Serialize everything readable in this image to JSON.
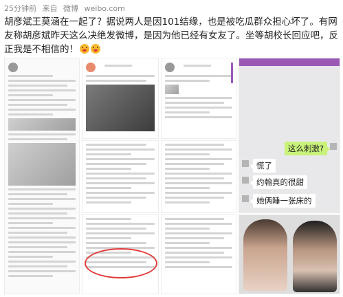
{
  "meta": {
    "time": "25分钟前",
    "from": "来自",
    "source": "微博",
    "site": "weibo.com"
  },
  "post": {
    "text": "胡彦斌王莫涵在一起了？据说两人是因101结缘，也是被吃瓜群众担心坏了。有网友称胡彦斌昨天这么决绝发微博，是因为他已经有女友了。坐等胡校长回应吧，反正我是不相信的！",
    "emojis": [
      "laugh-emoji",
      "laugh-emoji"
    ]
  },
  "images": {
    "count": 9,
    "chat": {
      "messages": [
        {
          "side": "right",
          "text": "这么刺激?"
        },
        {
          "side": "left",
          "text": "慌了"
        },
        {
          "side": "left",
          "text": "约翰真的很甜"
        },
        {
          "side": "left",
          "text": "她俩睡一张床的"
        }
      ]
    },
    "highlight_color": "#e23b3b"
  }
}
